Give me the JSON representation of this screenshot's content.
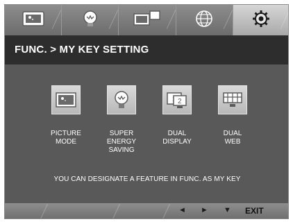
{
  "tabs": [
    {
      "icon": "picture-icon",
      "active": false
    },
    {
      "icon": "bulb-icon",
      "active": false
    },
    {
      "icon": "dual-display-icon",
      "active": false
    },
    {
      "icon": "globe-icon",
      "active": false
    },
    {
      "icon": "gear-icon",
      "active": true
    }
  ],
  "header": {
    "breadcrumb": "FUNC.  >  MY KEY SETTING"
  },
  "keys": [
    {
      "label": "PICTURE\nMODE",
      "icon": "picture-mode-icon"
    },
    {
      "label": "SUPER\nENERGY\nSAVING",
      "icon": "bulb-icon"
    },
    {
      "label": "DUAL\nDISPLAY",
      "icon": "dual-display-icon"
    },
    {
      "label": "DUAL\nWEB",
      "icon": "dual-web-icon"
    }
  ],
  "note": "YOU CAN DESIGNATE A FEATURE IN FUNC. AS MY KEY",
  "footer": {
    "left_arrow": "◄",
    "right_arrow": "►",
    "down_arrow": "▼",
    "exit_label": "EXIT"
  },
  "colors": {
    "tab_bg": "#7d7d7d",
    "active_tab_bg": "#bdbdbd",
    "header_bg": "#2d2d2d",
    "content_bg": "#595959",
    "footer_bg": "#7e7e7e"
  }
}
